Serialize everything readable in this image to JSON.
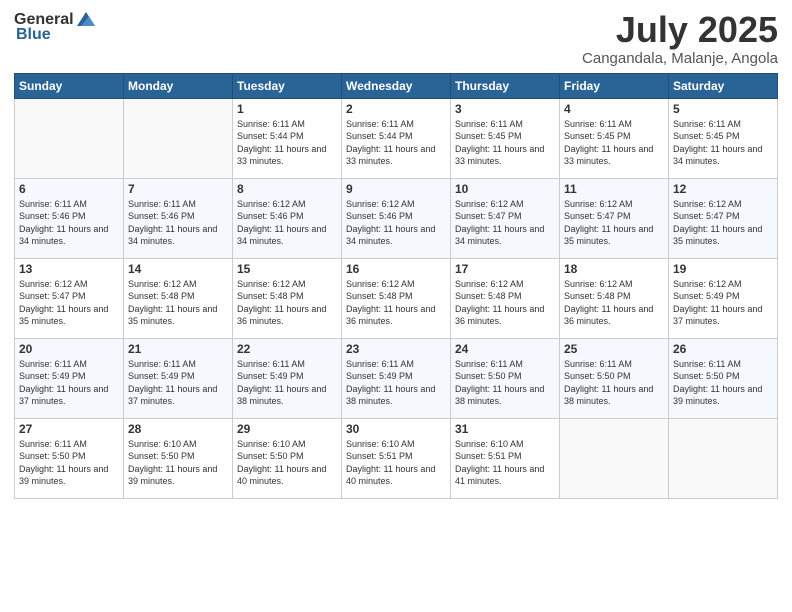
{
  "header": {
    "logo_general": "General",
    "logo_blue": "Blue",
    "month_year": "July 2025",
    "location": "Cangandala, Malanje, Angola"
  },
  "weekdays": [
    "Sunday",
    "Monday",
    "Tuesday",
    "Wednesday",
    "Thursday",
    "Friday",
    "Saturday"
  ],
  "weeks": [
    [
      {
        "day": "",
        "empty": true
      },
      {
        "day": "",
        "empty": true
      },
      {
        "day": "1",
        "sunrise": "6:11 AM",
        "sunset": "5:44 PM",
        "daylight": "11 hours and 33 minutes."
      },
      {
        "day": "2",
        "sunrise": "6:11 AM",
        "sunset": "5:44 PM",
        "daylight": "11 hours and 33 minutes."
      },
      {
        "day": "3",
        "sunrise": "6:11 AM",
        "sunset": "5:45 PM",
        "daylight": "11 hours and 33 minutes."
      },
      {
        "day": "4",
        "sunrise": "6:11 AM",
        "sunset": "5:45 PM",
        "daylight": "11 hours and 33 minutes."
      },
      {
        "day": "5",
        "sunrise": "6:11 AM",
        "sunset": "5:45 PM",
        "daylight": "11 hours and 34 minutes."
      }
    ],
    [
      {
        "day": "6",
        "sunrise": "6:11 AM",
        "sunset": "5:46 PM",
        "daylight": "11 hours and 34 minutes."
      },
      {
        "day": "7",
        "sunrise": "6:11 AM",
        "sunset": "5:46 PM",
        "daylight": "11 hours and 34 minutes."
      },
      {
        "day": "8",
        "sunrise": "6:12 AM",
        "sunset": "5:46 PM",
        "daylight": "11 hours and 34 minutes."
      },
      {
        "day": "9",
        "sunrise": "6:12 AM",
        "sunset": "5:46 PM",
        "daylight": "11 hours and 34 minutes."
      },
      {
        "day": "10",
        "sunrise": "6:12 AM",
        "sunset": "5:47 PM",
        "daylight": "11 hours and 34 minutes."
      },
      {
        "day": "11",
        "sunrise": "6:12 AM",
        "sunset": "5:47 PM",
        "daylight": "11 hours and 35 minutes."
      },
      {
        "day": "12",
        "sunrise": "6:12 AM",
        "sunset": "5:47 PM",
        "daylight": "11 hours and 35 minutes."
      }
    ],
    [
      {
        "day": "13",
        "sunrise": "6:12 AM",
        "sunset": "5:47 PM",
        "daylight": "11 hours and 35 minutes."
      },
      {
        "day": "14",
        "sunrise": "6:12 AM",
        "sunset": "5:48 PM",
        "daylight": "11 hours and 35 minutes."
      },
      {
        "day": "15",
        "sunrise": "6:12 AM",
        "sunset": "5:48 PM",
        "daylight": "11 hours and 36 minutes."
      },
      {
        "day": "16",
        "sunrise": "6:12 AM",
        "sunset": "5:48 PM",
        "daylight": "11 hours and 36 minutes."
      },
      {
        "day": "17",
        "sunrise": "6:12 AM",
        "sunset": "5:48 PM",
        "daylight": "11 hours and 36 minutes."
      },
      {
        "day": "18",
        "sunrise": "6:12 AM",
        "sunset": "5:48 PM",
        "daylight": "11 hours and 36 minutes."
      },
      {
        "day": "19",
        "sunrise": "6:12 AM",
        "sunset": "5:49 PM",
        "daylight": "11 hours and 37 minutes."
      }
    ],
    [
      {
        "day": "20",
        "sunrise": "6:11 AM",
        "sunset": "5:49 PM",
        "daylight": "11 hours and 37 minutes."
      },
      {
        "day": "21",
        "sunrise": "6:11 AM",
        "sunset": "5:49 PM",
        "daylight": "11 hours and 37 minutes."
      },
      {
        "day": "22",
        "sunrise": "6:11 AM",
        "sunset": "5:49 PM",
        "daylight": "11 hours and 38 minutes."
      },
      {
        "day": "23",
        "sunrise": "6:11 AM",
        "sunset": "5:49 PM",
        "daylight": "11 hours and 38 minutes."
      },
      {
        "day": "24",
        "sunrise": "6:11 AM",
        "sunset": "5:50 PM",
        "daylight": "11 hours and 38 minutes."
      },
      {
        "day": "25",
        "sunrise": "6:11 AM",
        "sunset": "5:50 PM",
        "daylight": "11 hours and 38 minutes."
      },
      {
        "day": "26",
        "sunrise": "6:11 AM",
        "sunset": "5:50 PM",
        "daylight": "11 hours and 39 minutes."
      }
    ],
    [
      {
        "day": "27",
        "sunrise": "6:11 AM",
        "sunset": "5:50 PM",
        "daylight": "11 hours and 39 minutes."
      },
      {
        "day": "28",
        "sunrise": "6:10 AM",
        "sunset": "5:50 PM",
        "daylight": "11 hours and 39 minutes."
      },
      {
        "day": "29",
        "sunrise": "6:10 AM",
        "sunset": "5:50 PM",
        "daylight": "11 hours and 40 minutes."
      },
      {
        "day": "30",
        "sunrise": "6:10 AM",
        "sunset": "5:51 PM",
        "daylight": "11 hours and 40 minutes."
      },
      {
        "day": "31",
        "sunrise": "6:10 AM",
        "sunset": "5:51 PM",
        "daylight": "11 hours and 41 minutes."
      },
      {
        "day": "",
        "empty": true
      },
      {
        "day": "",
        "empty": true
      }
    ]
  ]
}
